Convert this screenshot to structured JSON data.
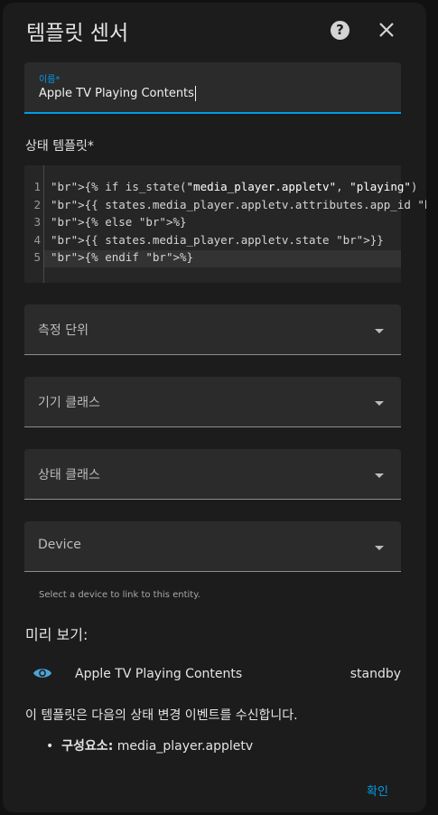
{
  "dialog": {
    "title": "템플릿 센서",
    "help_icon": "question-circle-icon",
    "close_icon": "close-icon"
  },
  "name_field": {
    "label": "이름*",
    "value": "Apple TV Playing Contents"
  },
  "state_template": {
    "label": "상태 템플릿*",
    "lines": [
      {
        "n": "1",
        "text": "{% if is_state(\"media_player.appletv\", \"playing\") %}"
      },
      {
        "n": "2",
        "text": "{{ states.media_player.appletv.attributes.app_id }}"
      },
      {
        "n": "3",
        "text": "{% else %}"
      },
      {
        "n": "4",
        "text": "{{ states.media_player.appletv.state }}"
      },
      {
        "n": "5",
        "text": "{% endif %}"
      }
    ]
  },
  "selects": {
    "unit": "측정 단위",
    "device_class": "기기 클래스",
    "state_class": "상태 클래스",
    "device": "Device"
  },
  "device_helper": "Select a device to link to this entity.",
  "preview": {
    "title": "미리 보기:",
    "icon": "eye-icon",
    "entity_name": "Apple TV Playing Contents",
    "state": "standby",
    "listen_text": "이 템플릿은 다음의 상태 변경 이벤트를 수신합니다.",
    "entity_label": "구성요소:",
    "entity_value": " media_player.appletv"
  },
  "actions": {
    "confirm": "확인"
  },
  "colors": {
    "accent": "#039be5",
    "surface": "#1c1c1c",
    "field": "#2b2b2b",
    "template_brace": "#ef5b6b"
  }
}
